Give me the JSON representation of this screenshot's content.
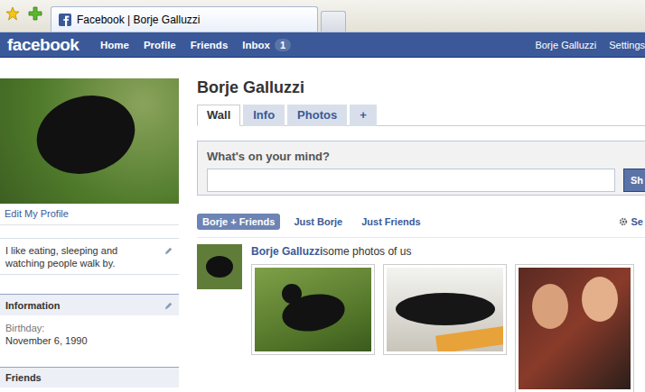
{
  "browser": {
    "tab_title": "Facebook | Borje Galluzzi"
  },
  "nav": {
    "logo": "facebook",
    "items": [
      {
        "label": "Home",
        "badge": ""
      },
      {
        "label": "Profile",
        "badge": ""
      },
      {
        "label": "Friends",
        "badge": ""
      },
      {
        "label": "Inbox",
        "badge": "1"
      }
    ],
    "account": [
      "Borje Galluzzi",
      "Settings"
    ]
  },
  "sidebar": {
    "edit_link": "Edit My Profile",
    "bio": "I like eating, sleeping and watching people walk by.",
    "info": {
      "title": "Information",
      "fields": [
        {
          "label": "Birthday:",
          "value": "November 6, 1990"
        }
      ]
    },
    "friends_title": "Friends"
  },
  "profile": {
    "name": "Borje Galluzzi",
    "tabs": [
      {
        "label": "Wall",
        "selected": true
      },
      {
        "label": "Info",
        "selected": false
      },
      {
        "label": "Photos",
        "selected": false
      },
      {
        "label": "+",
        "selected": false
      }
    ]
  },
  "publisher": {
    "prompt": "What's on your mind?",
    "button": "Sh"
  },
  "filters": {
    "items": [
      {
        "label": "Borje + Friends",
        "selected": true
      },
      {
        "label": "Just Borje",
        "selected": false
      },
      {
        "label": "Just Friends",
        "selected": false
      }
    ],
    "settings": "Se"
  },
  "posts": [
    {
      "author": "Borje Galluzzi",
      "text": "some photos of us",
      "photos": [
        {
          "kind": "cat-grass"
        },
        {
          "kind": "cat-rug"
        },
        {
          "kind": "couple"
        }
      ]
    }
  ]
}
